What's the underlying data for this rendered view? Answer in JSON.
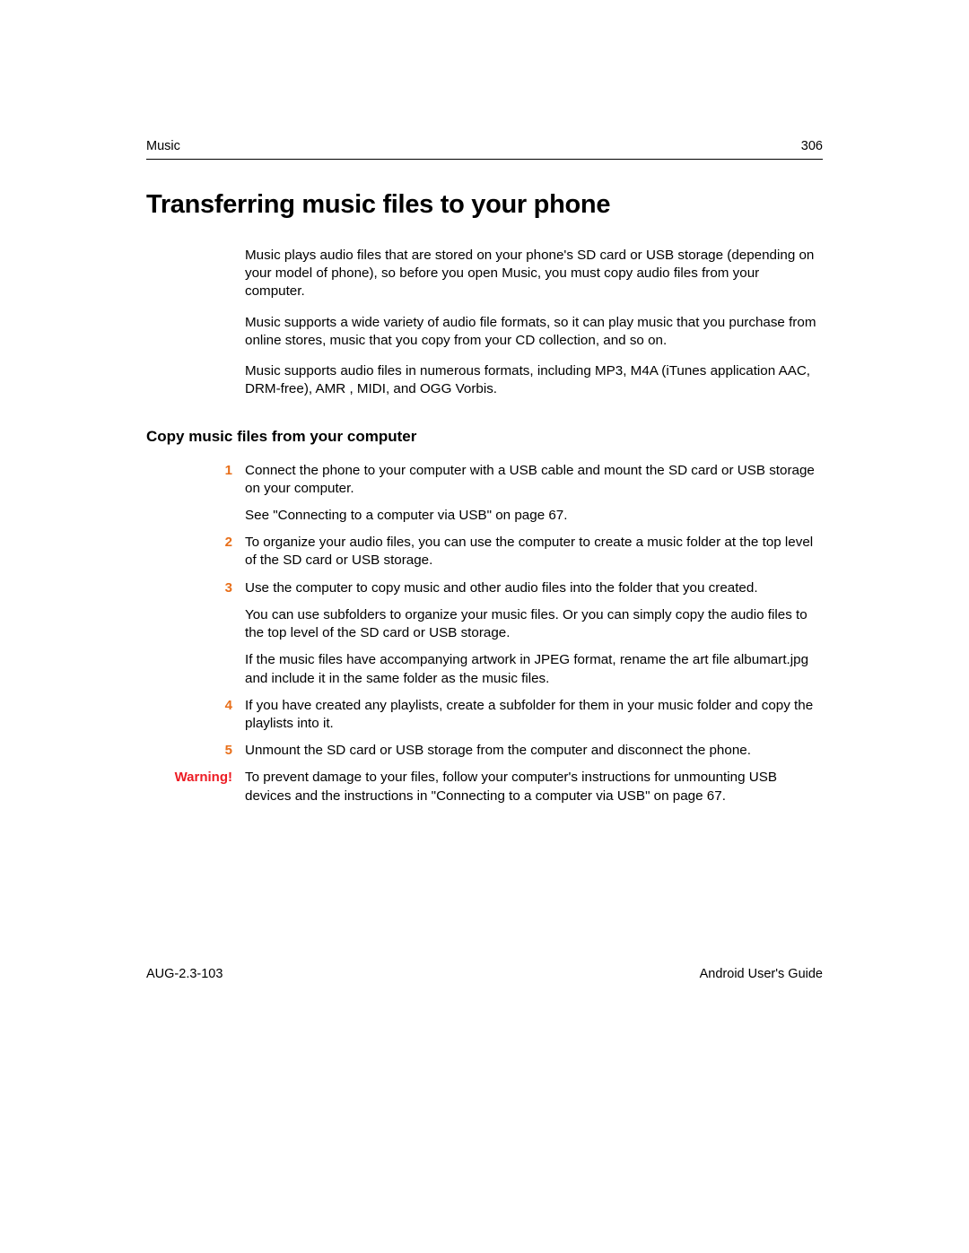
{
  "header": {
    "section": "Music",
    "page_number": "306"
  },
  "title": "Transferring music files to your phone",
  "intro": {
    "p1": "Music plays audio files that are stored on your phone's SD card or USB storage (depending on your model of phone), so before you open Music, you must copy audio files from your computer.",
    "p2": "Music supports a wide variety of audio file formats, so it can play music that you purchase from online stores, music that you copy from your CD collection, and so on.",
    "p3": "Music supports audio files in numerous formats, including MP3, M4A (iTunes application AAC, DRM-free), AMR , MIDI, and OGG Vorbis."
  },
  "section_heading": "Copy music files from your computer",
  "steps": [
    {
      "num": "1",
      "paras": [
        "Connect the phone to your computer with a USB cable and mount the SD card or USB storage on your computer.",
        "See \"Connecting to a computer via USB\" on page 67."
      ]
    },
    {
      "num": "2",
      "paras": [
        "To organize your audio files, you can use the computer to create a music folder at the top level of the SD card or USB storage."
      ]
    },
    {
      "num": "3",
      "paras": [
        "Use the computer to copy music and other audio files into the folder that you created.",
        "You can use subfolders to organize your music files. Or you can simply copy the audio files to the top level of the SD card or USB storage.",
        "If the music files have accompanying artwork in JPEG format, rename the art file albumart.jpg and include it in the same folder as the music files."
      ]
    },
    {
      "num": "4",
      "paras": [
        "If you have created any playlists, create a subfolder for them in your music folder and copy the playlists into it."
      ]
    },
    {
      "num": "5",
      "paras": [
        "Unmount the SD card or USB storage from the computer and disconnect the phone."
      ]
    }
  ],
  "warning": {
    "label": "Warning!",
    "text": "To prevent damage to your files, follow your computer's instructions for unmounting USB devices and the instructions in \"Connecting to a computer via USB\" on page 67."
  },
  "footer": {
    "doc_id": "AUG-2.3-103",
    "doc_title": "Android User's Guide"
  }
}
